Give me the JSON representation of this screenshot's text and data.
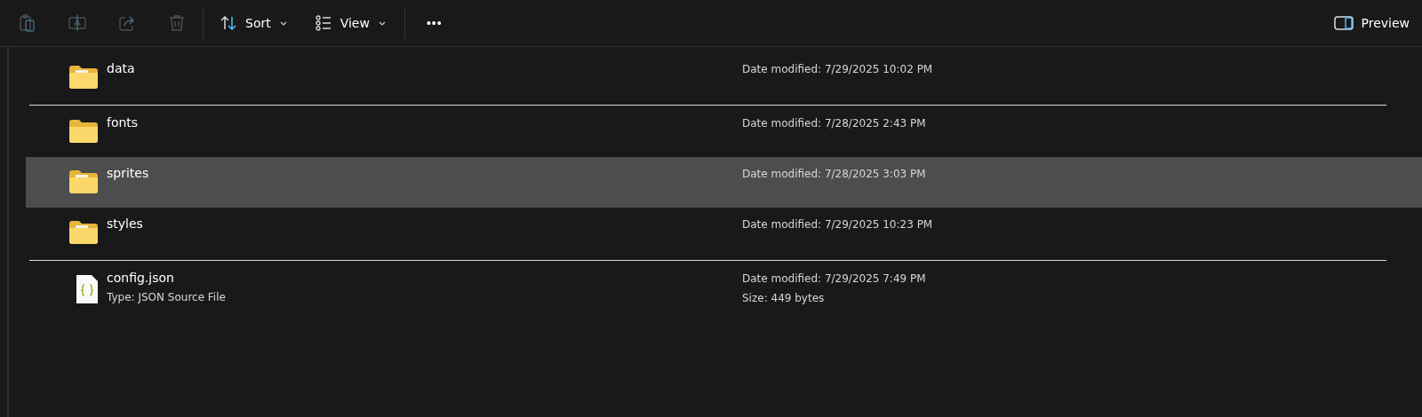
{
  "toolbar": {
    "actions": [
      {
        "kind": "paste",
        "disabled": true
      },
      {
        "kind": "rename",
        "disabled": true
      },
      {
        "kind": "share",
        "disabled": true
      },
      {
        "kind": "delete",
        "disabled": true
      }
    ],
    "menus": [
      {
        "kind": "sort",
        "label": "Sort"
      },
      {
        "kind": "view",
        "label": "View"
      }
    ],
    "more": "•••",
    "preview": {
      "label": "Preview"
    }
  },
  "items": [
    {
      "kind": "folder",
      "name": "data",
      "date": "Date modified: 7/29/2025 10:02 PM",
      "selected": false,
      "separator_below": true
    },
    {
      "kind": "folder-empty",
      "name": "fonts",
      "date": "Date modified: 7/28/2025 2:43 PM",
      "selected": false,
      "separator_below": false
    },
    {
      "kind": "folder",
      "name": "sprites",
      "date": "Date modified: 7/28/2025 3:03 PM",
      "selected": true,
      "separator_below": false
    },
    {
      "kind": "folder",
      "name": "styles",
      "date": "Date modified: 7/29/2025 10:23 PM",
      "selected": false,
      "separator_below": true
    },
    {
      "kind": "file",
      "name": "config.json",
      "type": "Type: JSON Source File",
      "date": "Date modified: 7/29/2025 7:49 PM",
      "size": "Size: 449 bytes",
      "selected": false,
      "separator_below": false
    }
  ]
}
